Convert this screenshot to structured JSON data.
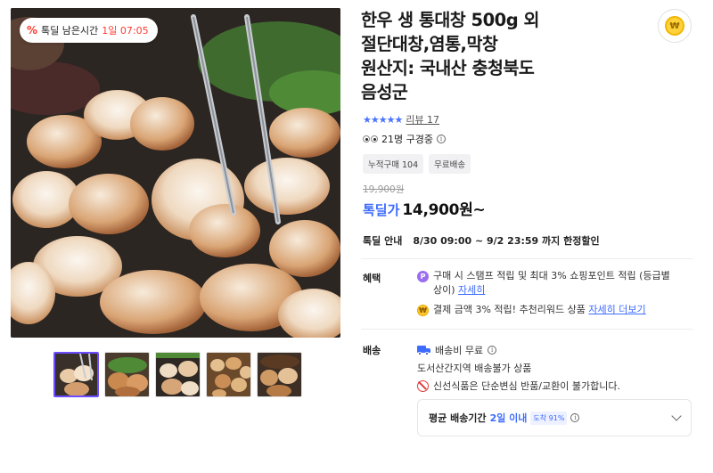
{
  "deal_badge": {
    "percent_icon": "%",
    "label": "톡딜 남은시간",
    "time": "1일 07:05"
  },
  "gallery": {
    "thumbnail_count": 5,
    "selected_index": 0
  },
  "product": {
    "title_lines": [
      "한우 생 통대창 500g 외",
      "절단대창,염통,막창",
      "원산지: 국내산 충청북도",
      "음성군"
    ],
    "stars": "★★★★★",
    "review_text": "리뷰 17",
    "watchers_text": "21명 구경중",
    "info_icon": "i",
    "tags": [
      "누적구매 104",
      "무료배송"
    ],
    "original_price": "19,900원",
    "deal_label": "톡딜가",
    "deal_price": "14,900원~"
  },
  "share_coin": {
    "icon": "share-coin-icon",
    "glyph": "₩"
  },
  "deal_info": {
    "label": "톡딜 안내",
    "value": "8/30 09:00 ~ 9/2 23:59 까지 한정할인"
  },
  "benefits": {
    "label": "혜택",
    "items": [
      {
        "icon_glyph": "P",
        "text": "구매 시 스탬프 적립 및 최대 3% 쇼핑포인트 적립 (등급별 상이)",
        "link": "자세히"
      },
      {
        "icon_glyph": "₩",
        "text": "결제 금액 3% 적립! 추천리워드 상품",
        "link": "자세히 더보기"
      }
    ]
  },
  "shipping": {
    "label": "배송",
    "free_text": "배송비 무료",
    "region_text": "도서산간지역 배송불가 상품",
    "fresh_text": "신선식품은 단순변심 반품/교환이 불가합니다."
  },
  "delivery": {
    "label": "평균 배송기간",
    "value": "2일 이내",
    "badge": "도착 91%"
  },
  "colors": {
    "accent_blue": "#3d6bff",
    "deal_red": "#ff3b30",
    "selected_thumb": "#6b4cff"
  }
}
